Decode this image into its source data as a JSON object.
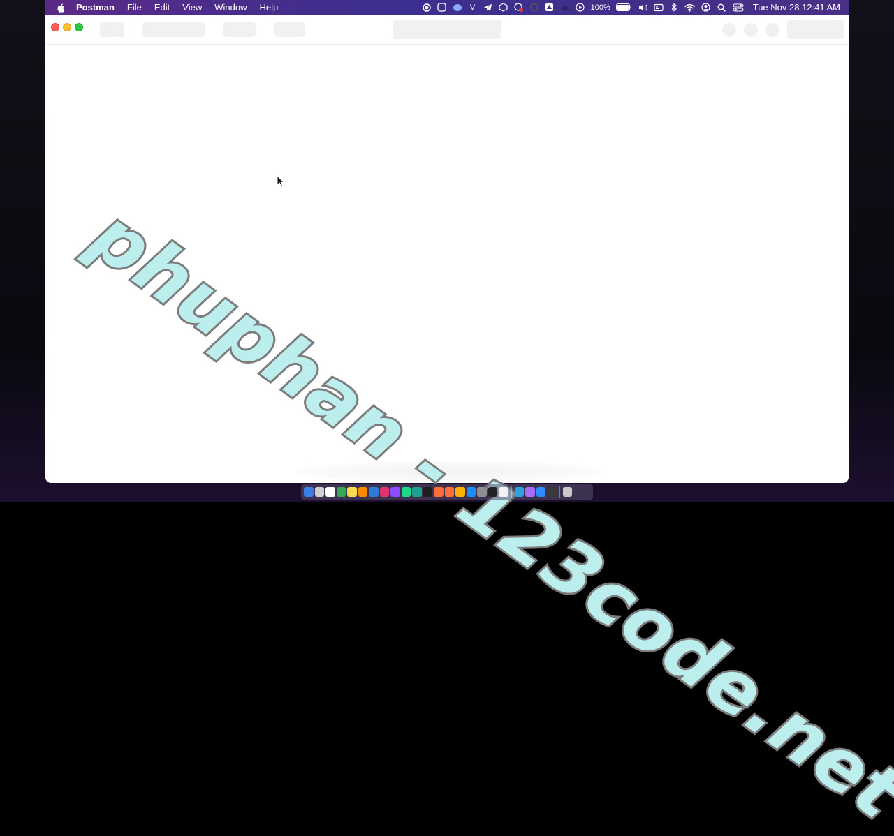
{
  "menubar": {
    "app_name": "Postman",
    "menus": [
      "File",
      "Edit",
      "View",
      "Window",
      "Help"
    ],
    "battery": "100%",
    "clock": "Tue Nov 28  12:41 AM",
    "status_icons": [
      "record-icon",
      "screen-icon",
      "mastodon-icon",
      "vim-icon",
      "telegram-icon",
      "box-icon",
      "cloud-sync-icon",
      "circle-icon",
      "drive-icon",
      "cloud-icon",
      "play-icon",
      "battery-icon",
      "volume-icon",
      "display-icon",
      "bluetooth-icon",
      "wifi-icon",
      "user-icon",
      "search-icon",
      "control-center-icon"
    ]
  },
  "watermark": {
    "text": "phuphan - 123code.net"
  },
  "window": {
    "title_placeholder": ""
  },
  "dock": {
    "icons": [
      "finder",
      "launchpad",
      "calendar",
      "chrome",
      "notes",
      "sublime",
      "vscode",
      "intellij",
      "phpstorm",
      "pycharm",
      "datagrip",
      "terminal",
      "postman",
      "firefox",
      "sketch",
      "safari",
      "settings",
      "capcut",
      "notion",
      "telegram",
      "messenger",
      "zoom",
      "screen",
      "trash"
    ],
    "colors": [
      "#3b7ee8",
      "#d0d0d0",
      "#ffffff",
      "#34a853",
      "#f7d94c",
      "#ff8a00",
      "#2d7bd6",
      "#e0336c",
      "#8a4dff",
      "#21d789",
      "#1f9f8f",
      "#1e1e1e",
      "#ff6c37",
      "#ff7139",
      "#fdb300",
      "#1d8cf8",
      "#8e8e93",
      "#222222",
      "#f2f2f2",
      "#2aa3df",
      "#a86cf7",
      "#2d8cff",
      "#3a3a3a",
      "#c9c9c9"
    ]
  }
}
